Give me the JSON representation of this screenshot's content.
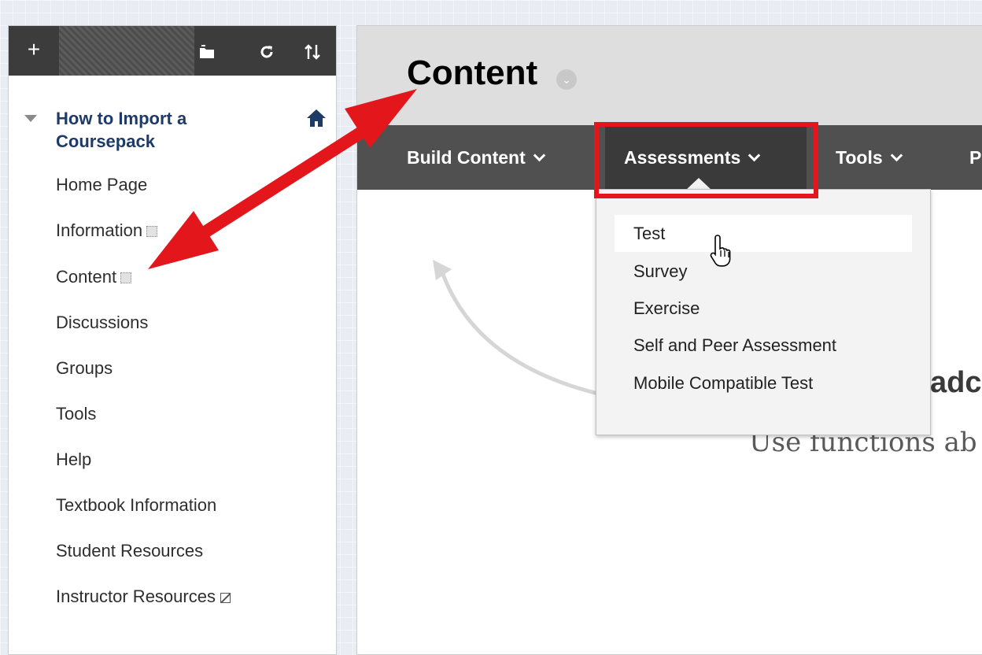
{
  "toolbar": {
    "add_icon": "plus-icon",
    "icons": [
      "folder-icon",
      "refresh-icon",
      "sort-icon"
    ]
  },
  "course": {
    "title": "How to Import a Coursepack",
    "home_icon": "home-icon"
  },
  "menu": {
    "items": [
      {
        "label": "Home Page"
      },
      {
        "label": "Information",
        "badge": "hidden-icon"
      },
      {
        "label": "Content",
        "badge": "hidden-icon"
      },
      {
        "label": "Discussions"
      },
      {
        "label": "Groups"
      },
      {
        "label": "Tools"
      },
      {
        "label": "Help"
      },
      {
        "label": "Textbook Information"
      },
      {
        "label": "Student Resources"
      },
      {
        "label": "Instructor Resources",
        "badge": "external-link-icon"
      }
    ]
  },
  "main": {
    "page_title": "Content",
    "tabs": [
      {
        "label": "Build Content"
      },
      {
        "label": "Assessments"
      },
      {
        "label": "Tools"
      },
      {
        "label": "P"
      }
    ],
    "dropdown": {
      "items": [
        "Test",
        "Survey",
        "Exercise",
        "Self and Peer Assessment",
        "Mobile Compatible Test"
      ],
      "hovered": "Test"
    },
    "background_heading": "adc",
    "background_subtext": "Use functions ab"
  },
  "colors": {
    "annotation_red": "#e3171b",
    "action_bar": "#505050",
    "course_title": "#1e3a66"
  }
}
